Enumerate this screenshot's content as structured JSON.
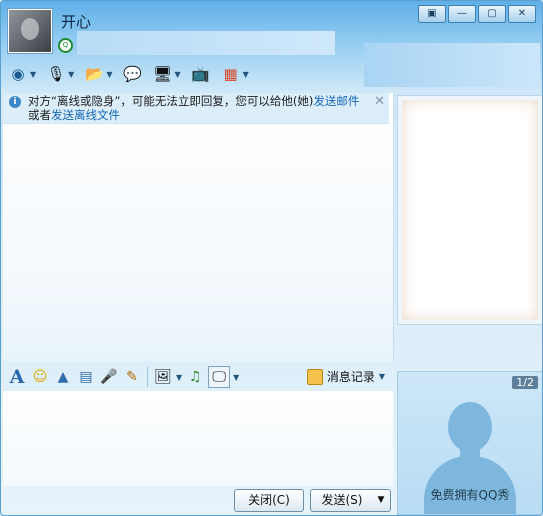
{
  "window": {
    "controls": [
      "▣",
      "—",
      "▢",
      "✕"
    ]
  },
  "contact": {
    "name": "开心"
  },
  "toolbar": {
    "items": [
      {
        "icon": "webcam-icon",
        "glyph": "◉"
      },
      {
        "icon": "microphone-icon",
        "glyph": "🎙"
      },
      {
        "icon": "file-transfer-icon",
        "glyph": "📂"
      },
      {
        "icon": "message-icon",
        "glyph": "💬"
      },
      {
        "icon": "remote-assist-icon",
        "glyph": "🖥"
      },
      {
        "icon": "share-screen-icon",
        "glyph": "📺"
      },
      {
        "icon": "apps-icon",
        "glyph": "▦"
      }
    ]
  },
  "notice": {
    "prefix": "对方“离线或隐身”，可能无法立即回复，您可以给他(她)",
    "link1": "发送邮件",
    "middle": "或者",
    "link2": "发送离线文件",
    "close": "✕"
  },
  "input_toolbar": {
    "font_glyph": "A",
    "items": [
      {
        "icon": "emoji-icon",
        "glyph": "☺"
      },
      {
        "icon": "magic-emoticon-icon",
        "glyph": "▲"
      },
      {
        "icon": "screenshot-icon",
        "glyph": "▤"
      },
      {
        "icon": "voice-message-icon",
        "glyph": "🎤"
      },
      {
        "icon": "handwriting-icon",
        "glyph": "✎"
      },
      {
        "icon": "image-icon",
        "glyph": "🖼"
      },
      {
        "icon": "music-icon",
        "glyph": "♫"
      },
      {
        "icon": "screen-capture-icon",
        "glyph": "🖵"
      }
    ],
    "history_label": "消息记录",
    "history_caret": "▼"
  },
  "buttons": {
    "close": "关闭(C)",
    "send": "发送(S)",
    "send_menu": "▼"
  },
  "show": {
    "page_indicator": "1/2",
    "label": "免费拥有QQ秀"
  }
}
